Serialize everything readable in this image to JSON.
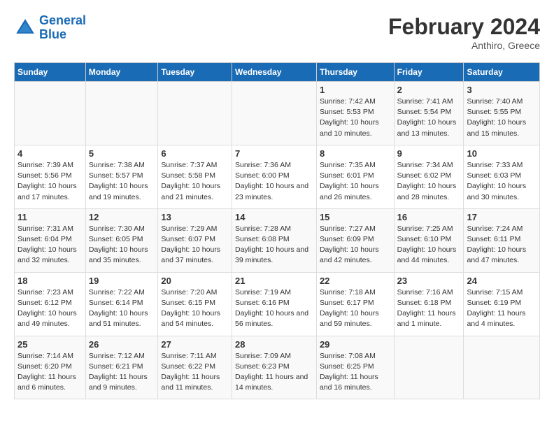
{
  "header": {
    "logo_line1": "General",
    "logo_line2": "Blue",
    "main_title": "February 2024",
    "subtitle": "Anthiro, Greece"
  },
  "days_of_week": [
    "Sunday",
    "Monday",
    "Tuesday",
    "Wednesday",
    "Thursday",
    "Friday",
    "Saturday"
  ],
  "weeks": [
    [
      {
        "day": "",
        "info": ""
      },
      {
        "day": "",
        "info": ""
      },
      {
        "day": "",
        "info": ""
      },
      {
        "day": "",
        "info": ""
      },
      {
        "day": "1",
        "info": "Sunrise: 7:42 AM\nSunset: 5:53 PM\nDaylight: 10 hours\nand 10 minutes."
      },
      {
        "day": "2",
        "info": "Sunrise: 7:41 AM\nSunset: 5:54 PM\nDaylight: 10 hours\nand 13 minutes."
      },
      {
        "day": "3",
        "info": "Sunrise: 7:40 AM\nSunset: 5:55 PM\nDaylight: 10 hours\nand 15 minutes."
      }
    ],
    [
      {
        "day": "4",
        "info": "Sunrise: 7:39 AM\nSunset: 5:56 PM\nDaylight: 10 hours\nand 17 minutes."
      },
      {
        "day": "5",
        "info": "Sunrise: 7:38 AM\nSunset: 5:57 PM\nDaylight: 10 hours\nand 19 minutes."
      },
      {
        "day": "6",
        "info": "Sunrise: 7:37 AM\nSunset: 5:58 PM\nDaylight: 10 hours\nand 21 minutes."
      },
      {
        "day": "7",
        "info": "Sunrise: 7:36 AM\nSunset: 6:00 PM\nDaylight: 10 hours\nand 23 minutes."
      },
      {
        "day": "8",
        "info": "Sunrise: 7:35 AM\nSunset: 6:01 PM\nDaylight: 10 hours\nand 26 minutes."
      },
      {
        "day": "9",
        "info": "Sunrise: 7:34 AM\nSunset: 6:02 PM\nDaylight: 10 hours\nand 28 minutes."
      },
      {
        "day": "10",
        "info": "Sunrise: 7:33 AM\nSunset: 6:03 PM\nDaylight: 10 hours\nand 30 minutes."
      }
    ],
    [
      {
        "day": "11",
        "info": "Sunrise: 7:31 AM\nSunset: 6:04 PM\nDaylight: 10 hours\nand 32 minutes."
      },
      {
        "day": "12",
        "info": "Sunrise: 7:30 AM\nSunset: 6:05 PM\nDaylight: 10 hours\nand 35 minutes."
      },
      {
        "day": "13",
        "info": "Sunrise: 7:29 AM\nSunset: 6:07 PM\nDaylight: 10 hours\nand 37 minutes."
      },
      {
        "day": "14",
        "info": "Sunrise: 7:28 AM\nSunset: 6:08 PM\nDaylight: 10 hours\nand 39 minutes."
      },
      {
        "day": "15",
        "info": "Sunrise: 7:27 AM\nSunset: 6:09 PM\nDaylight: 10 hours\nand 42 minutes."
      },
      {
        "day": "16",
        "info": "Sunrise: 7:25 AM\nSunset: 6:10 PM\nDaylight: 10 hours\nand 44 minutes."
      },
      {
        "day": "17",
        "info": "Sunrise: 7:24 AM\nSunset: 6:11 PM\nDaylight: 10 hours\nand 47 minutes."
      }
    ],
    [
      {
        "day": "18",
        "info": "Sunrise: 7:23 AM\nSunset: 6:12 PM\nDaylight: 10 hours\nand 49 minutes."
      },
      {
        "day": "19",
        "info": "Sunrise: 7:22 AM\nSunset: 6:14 PM\nDaylight: 10 hours\nand 51 minutes."
      },
      {
        "day": "20",
        "info": "Sunrise: 7:20 AM\nSunset: 6:15 PM\nDaylight: 10 hours\nand 54 minutes."
      },
      {
        "day": "21",
        "info": "Sunrise: 7:19 AM\nSunset: 6:16 PM\nDaylight: 10 hours\nand 56 minutes."
      },
      {
        "day": "22",
        "info": "Sunrise: 7:18 AM\nSunset: 6:17 PM\nDaylight: 10 hours\nand 59 minutes."
      },
      {
        "day": "23",
        "info": "Sunrise: 7:16 AM\nSunset: 6:18 PM\nDaylight: 11 hours\nand 1 minute."
      },
      {
        "day": "24",
        "info": "Sunrise: 7:15 AM\nSunset: 6:19 PM\nDaylight: 11 hours\nand 4 minutes."
      }
    ],
    [
      {
        "day": "25",
        "info": "Sunrise: 7:14 AM\nSunset: 6:20 PM\nDaylight: 11 hours\nand 6 minutes."
      },
      {
        "day": "26",
        "info": "Sunrise: 7:12 AM\nSunset: 6:21 PM\nDaylight: 11 hours\nand 9 minutes."
      },
      {
        "day": "27",
        "info": "Sunrise: 7:11 AM\nSunset: 6:22 PM\nDaylight: 11 hours\nand 11 minutes."
      },
      {
        "day": "28",
        "info": "Sunrise: 7:09 AM\nSunset: 6:23 PM\nDaylight: 11 hours\nand 14 minutes."
      },
      {
        "day": "29",
        "info": "Sunrise: 7:08 AM\nSunset: 6:25 PM\nDaylight: 11 hours\nand 16 minutes."
      },
      {
        "day": "",
        "info": ""
      },
      {
        "day": "",
        "info": ""
      }
    ]
  ]
}
